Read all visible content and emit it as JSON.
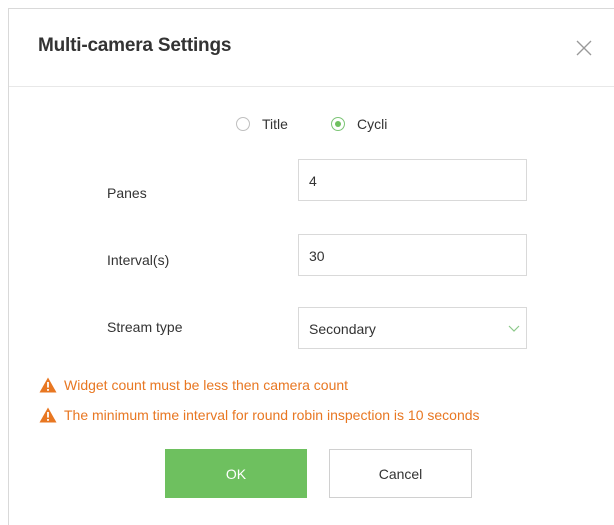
{
  "dialog": {
    "title": "Multi-camera Settings",
    "close_icon": "close-icon"
  },
  "mode": {
    "options": [
      {
        "label": "Title",
        "checked": false
      },
      {
        "label": "Cycli",
        "checked": true
      }
    ]
  },
  "fields": {
    "panes": {
      "label": "Panes",
      "value": "4"
    },
    "interval": {
      "label": "Interval(s)",
      "value": "30"
    },
    "stream_type": {
      "label": "Stream type",
      "value": "Secondary"
    }
  },
  "warnings": [
    "Widget count must be less then camera count",
    "The minimum time interval for round robin inspection is 10 seconds"
  ],
  "buttons": {
    "ok": "OK",
    "cancel": "Cancel"
  },
  "colors": {
    "accent": "#6ec05f",
    "warning": "#e87722",
    "border": "#d9d9d9",
    "text": "#333333"
  },
  "icons": {
    "close": "close-icon",
    "warning": "warning-icon",
    "dropdown": "chevron-down-icon"
  }
}
